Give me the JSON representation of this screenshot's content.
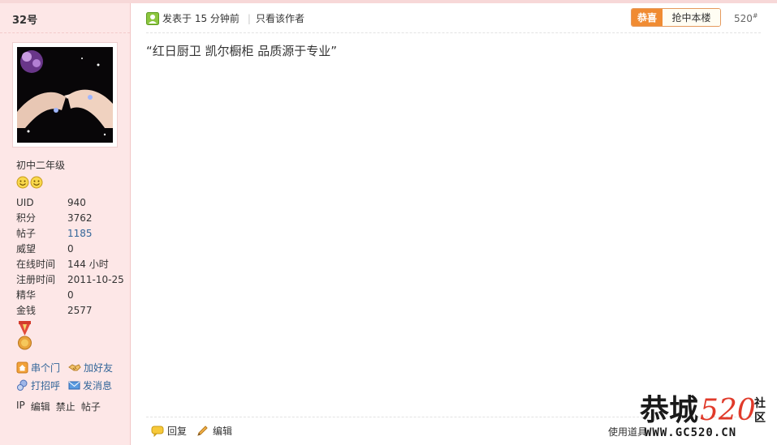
{
  "user": {
    "floor_name": "32号",
    "rank": "初中二年级",
    "stats": [
      {
        "label": "UID",
        "value": "940",
        "link": false
      },
      {
        "label": "积分",
        "value": "3762",
        "link": false
      },
      {
        "label": "帖子",
        "value": "1185",
        "link": true
      },
      {
        "label": "威望",
        "value": "0",
        "link": false
      },
      {
        "label": "在线时间",
        "value": "144 小时",
        "link": false
      },
      {
        "label": "注册时间",
        "value": "2011-10-25",
        "link": false
      },
      {
        "label": "精华",
        "value": "0",
        "link": false
      },
      {
        "label": "金钱",
        "value": "2577",
        "link": false
      }
    ],
    "actions": {
      "visit": "串个门",
      "add_friend": "加好友",
      "greet": "打招呼",
      "message": "发消息"
    },
    "admin": {
      "ip": "IP",
      "edit": "编辑",
      "ban": "禁止",
      "posts": "帖子"
    }
  },
  "post": {
    "posted_at": "发表于 15 分钟前",
    "only_author": "只看该作者",
    "congrats_label": "恭喜",
    "claim_label": "抢中本楼",
    "floor_number": "520",
    "floor_mark": "#",
    "body": "“红日厨卫 凯尔橱柜 品质源于专业”",
    "reply_label": "回复",
    "edit_label": "编辑",
    "use_tools_label": "使用道具"
  },
  "watermark": {
    "logo_text": "恭城",
    "logo_number": "520",
    "logo_suffix_top": "社",
    "logo_suffix_bottom": "区",
    "url": "WWW.GC520.CN"
  }
}
